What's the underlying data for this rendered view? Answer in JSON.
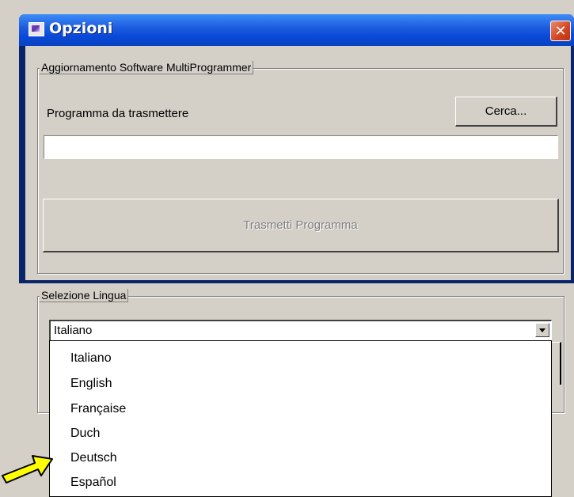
{
  "window": {
    "title": "Opzioni",
    "close_glyph": "✕"
  },
  "software_group": {
    "label": "Aggiornamento Software MultiProgrammer",
    "program_label": "Programma da trasmettere",
    "browse_button": "Cerca...",
    "program_path_value": "",
    "transmit_button": "Trasmetti Programma"
  },
  "language_group": {
    "label": "Selezione Lingua",
    "selected": "Italiano",
    "options": [
      "Italiano",
      "English",
      "Française",
      "Duch",
      "Deutsch",
      "Español"
    ]
  },
  "annotation": {
    "arrow_color": "#ffff00",
    "points_to": "Deutsch"
  },
  "colors": {
    "title_bar": "#0a49d9",
    "close_button": "#d2431f",
    "window_bg": "#d4d0c8"
  }
}
